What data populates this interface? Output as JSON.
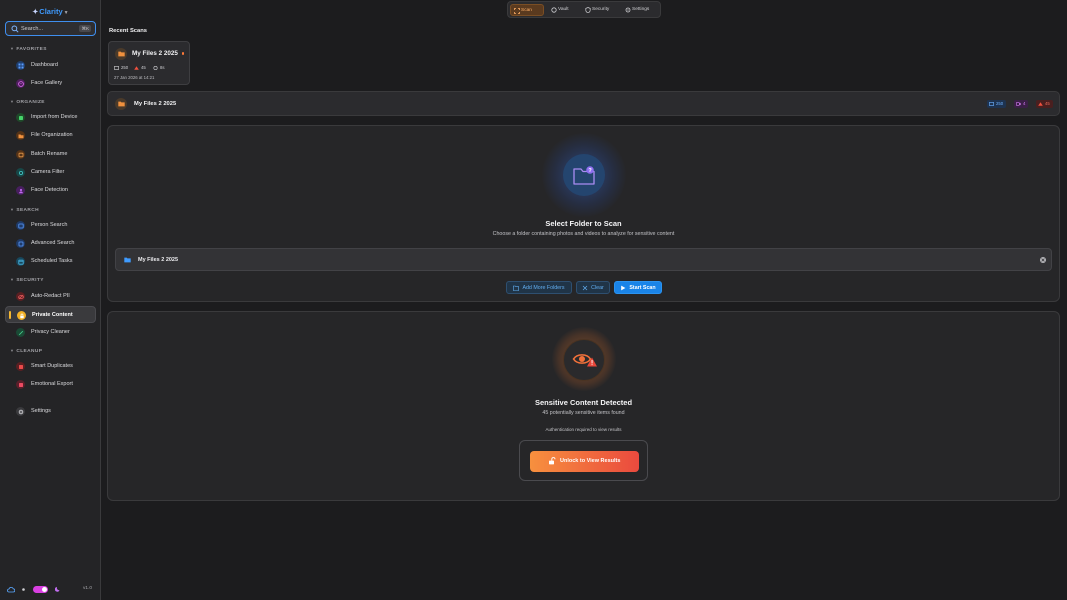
{
  "app": {
    "name": "Clarity"
  },
  "search": {
    "placeholder": "Search...",
    "shortcut": "⌘K"
  },
  "sidebar": {
    "sections": [
      {
        "label": "FAVORITES",
        "items": [
          {
            "label": "Dashboard",
            "icon": "grid-icon",
            "color": "#2b6fd6"
          },
          {
            "label": "Face Gallery",
            "icon": "face-icon",
            "color": "#b23ec9"
          }
        ]
      },
      {
        "label": "ORGANIZE",
        "items": [
          {
            "label": "Import from Device",
            "icon": "import-icon",
            "color": "#2fae4a"
          },
          {
            "label": "File Organization",
            "icon": "folder-icon",
            "color": "#d9772b"
          },
          {
            "label": "Batch Rename",
            "icon": "rename-icon",
            "color": "#c9772f"
          },
          {
            "label": "Camera Filter",
            "icon": "camera-icon",
            "color": "#2a9a9a"
          },
          {
            "label": "Face Detection",
            "icon": "person-icon",
            "color": "#9a3fbf"
          }
        ]
      },
      {
        "label": "SEARCH",
        "items": [
          {
            "label": "Person Search",
            "icon": "person-search-icon",
            "color": "#2b6fd6"
          },
          {
            "label": "Advanced Search",
            "icon": "filter-icon",
            "color": "#2b6fd6"
          },
          {
            "label": "Scheduled Tasks",
            "icon": "calendar-icon",
            "color": "#2a8fb9"
          }
        ]
      },
      {
        "label": "SECURITY",
        "items": [
          {
            "label": "Auto-Redact PII",
            "icon": "eye-slash-icon",
            "color": "#d64545"
          },
          {
            "label": "Private Content",
            "icon": "lock-icon",
            "color": "#f2b127",
            "active": true
          },
          {
            "label": "Privacy Cleaner",
            "icon": "broom-icon",
            "color": "#2f9a6a"
          }
        ]
      },
      {
        "label": "CLEANUP",
        "items": [
          {
            "label": "Smart Duplicates",
            "icon": "duplicate-icon",
            "color": "#d64545"
          },
          {
            "label": "Emotional Export",
            "icon": "heart-icon",
            "color": "#d6455a"
          }
        ]
      }
    ],
    "settings": {
      "label": "Settings",
      "icon": "gear-icon"
    },
    "version": "v1.0"
  },
  "tabs": [
    {
      "label": "Scan",
      "icon": "scan-icon",
      "active": true
    },
    {
      "label": "Vault",
      "icon": "vault-icon"
    },
    {
      "label": "Security",
      "icon": "shield-icon"
    },
    {
      "label": "Settings",
      "icon": "gear-icon"
    }
  ],
  "recent_scans": {
    "title": "Recent Scans",
    "card": {
      "name": "My Files 2 2025",
      "files": "250",
      "flagged": "45",
      "duration": "8s",
      "date": "27 Jan 2026 at 14:21"
    }
  },
  "folder_bar": {
    "name": "My Files 2 2025",
    "photos": "250",
    "videos": "4",
    "flagged": "45"
  },
  "select_panel": {
    "title": "Select Folder to Scan",
    "subtitle": "Choose a folder containing photos and videos to analyze for sensitive content",
    "selected_folder": "My Files 2 2025",
    "add_label": "Add More Folders",
    "clear_label": "Clear",
    "start_label": "Start Scan"
  },
  "result_panel": {
    "title": "Sensitive Content Detected",
    "subtitle": "45 potentially sensitive items found",
    "auth_note": "Authentication required to view results",
    "unlock_label": "Unlock to View Results"
  },
  "colors": {
    "accent": "#1a84e8",
    "warning": "#f2713a",
    "brand": "#3f9bff"
  }
}
